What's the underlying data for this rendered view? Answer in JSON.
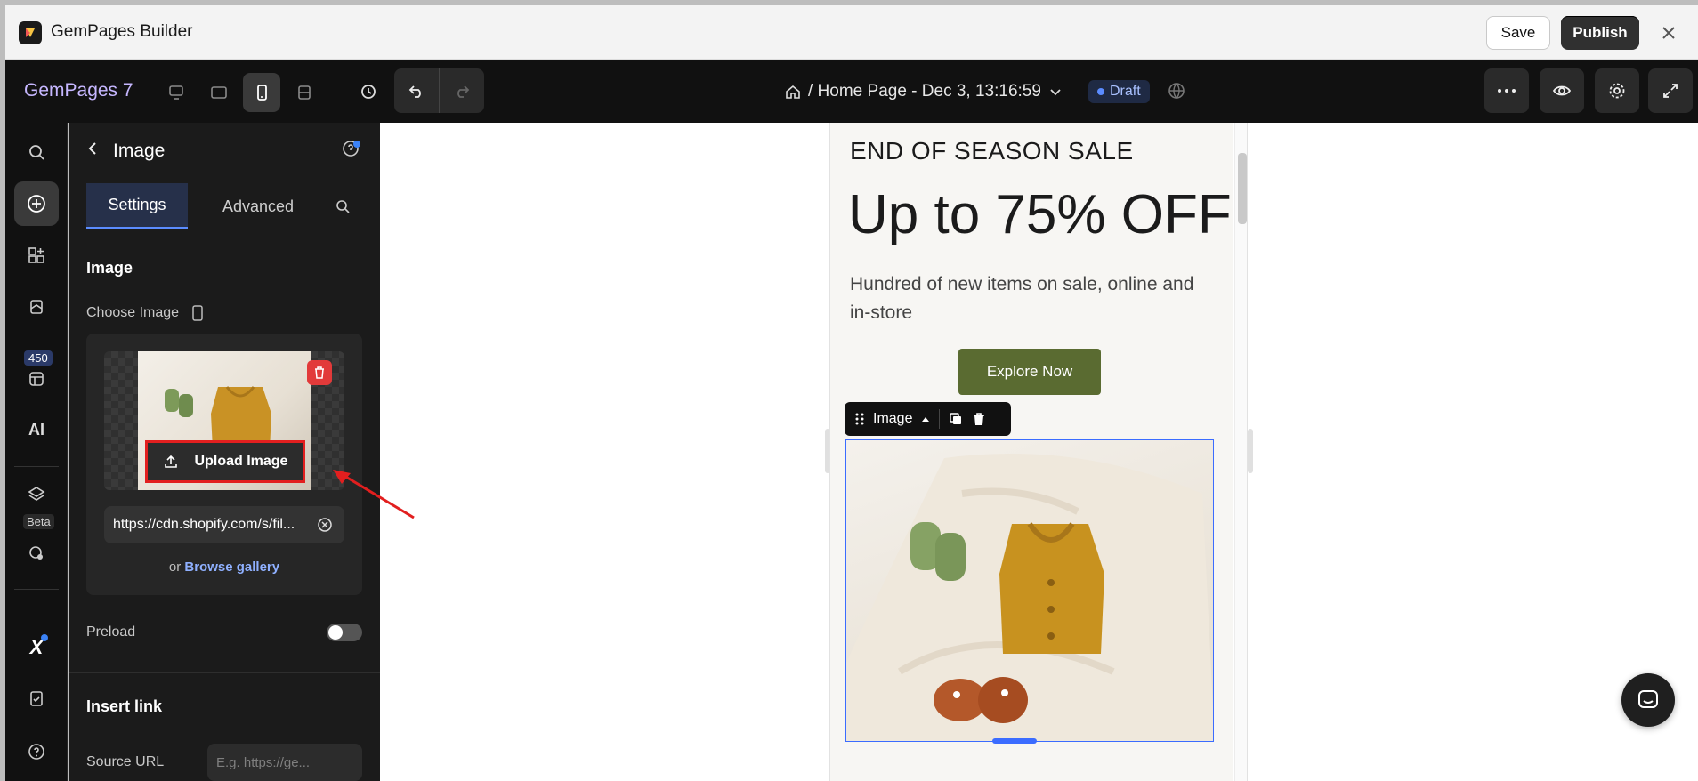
{
  "window": {
    "app_title": "GemPages Builder",
    "save_label": "Save",
    "publish_label": "Publish"
  },
  "header": {
    "brand": "GemPages 7",
    "page_selector": "/ Home Page - Dec 3, 13:16:59",
    "status_badge": "Draft"
  },
  "rail": {
    "badge_count": "450",
    "beta_label": "Beta",
    "ai_label": "AI"
  },
  "panel": {
    "title": "Image",
    "tabs": [
      "Settings",
      "Advanced"
    ],
    "section_image": "Image",
    "choose_image_label": "Choose Image",
    "upload_button": "Upload Image",
    "image_url": "https://cdn.shopify.com/s/fil...",
    "or_text": "or",
    "browse_gallery": "Browse gallery",
    "preload_label": "Preload",
    "preload_enabled": false,
    "section_insert_link": "Insert link",
    "source_url_label": "Source URL",
    "source_url_placeholder": "E.g. https://ge..."
  },
  "canvas": {
    "eyebrow": "END OF SEASON SALE",
    "headline": "Up to 75% OFF",
    "subtext": "Hundred of new items on sale, online and in-store",
    "cta": "Explore Now",
    "element_toolbar_label": "Image"
  },
  "colors": {
    "accent": "#5b8cff",
    "cta_green": "#5a6b31",
    "annotation_red": "#e21f1f"
  }
}
